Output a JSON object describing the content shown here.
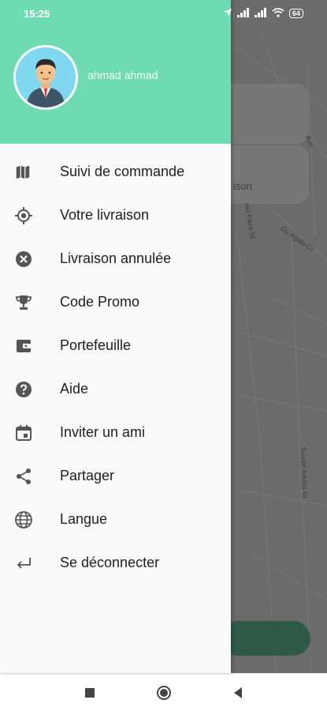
{
  "status_bar": {
    "time": "15:25",
    "battery": "64"
  },
  "drawer": {
    "header_color": "#6fdbb3",
    "user_name": "ahmad ahmad",
    "items": [
      {
        "label": "Suivi de commande",
        "icon": "map-icon"
      },
      {
        "label": "Votre livraison",
        "icon": "location-target-icon"
      },
      {
        "label": "Livraison annulée",
        "icon": "cancel-circle-icon"
      },
      {
        "label": "Code Promo",
        "icon": "trophy-icon"
      },
      {
        "label": "Portefeuille",
        "icon": "wallet-icon"
      },
      {
        "label": "Aide",
        "icon": "help-icon"
      },
      {
        "label": "Inviter un ami",
        "icon": "calendar-icon"
      },
      {
        "label": "Partager",
        "icon": "share-icon"
      },
      {
        "label": "Langue",
        "icon": "globe-icon"
      },
      {
        "label": "Se déconnecter",
        "icon": "logout-arrow-icon"
      }
    ]
  },
  "map": {
    "card_label": "ison",
    "streets": [
      "Ave",
      "mu Fikre St",
      "Gu Agabi Ct",
      "Susan Aduba St"
    ]
  }
}
